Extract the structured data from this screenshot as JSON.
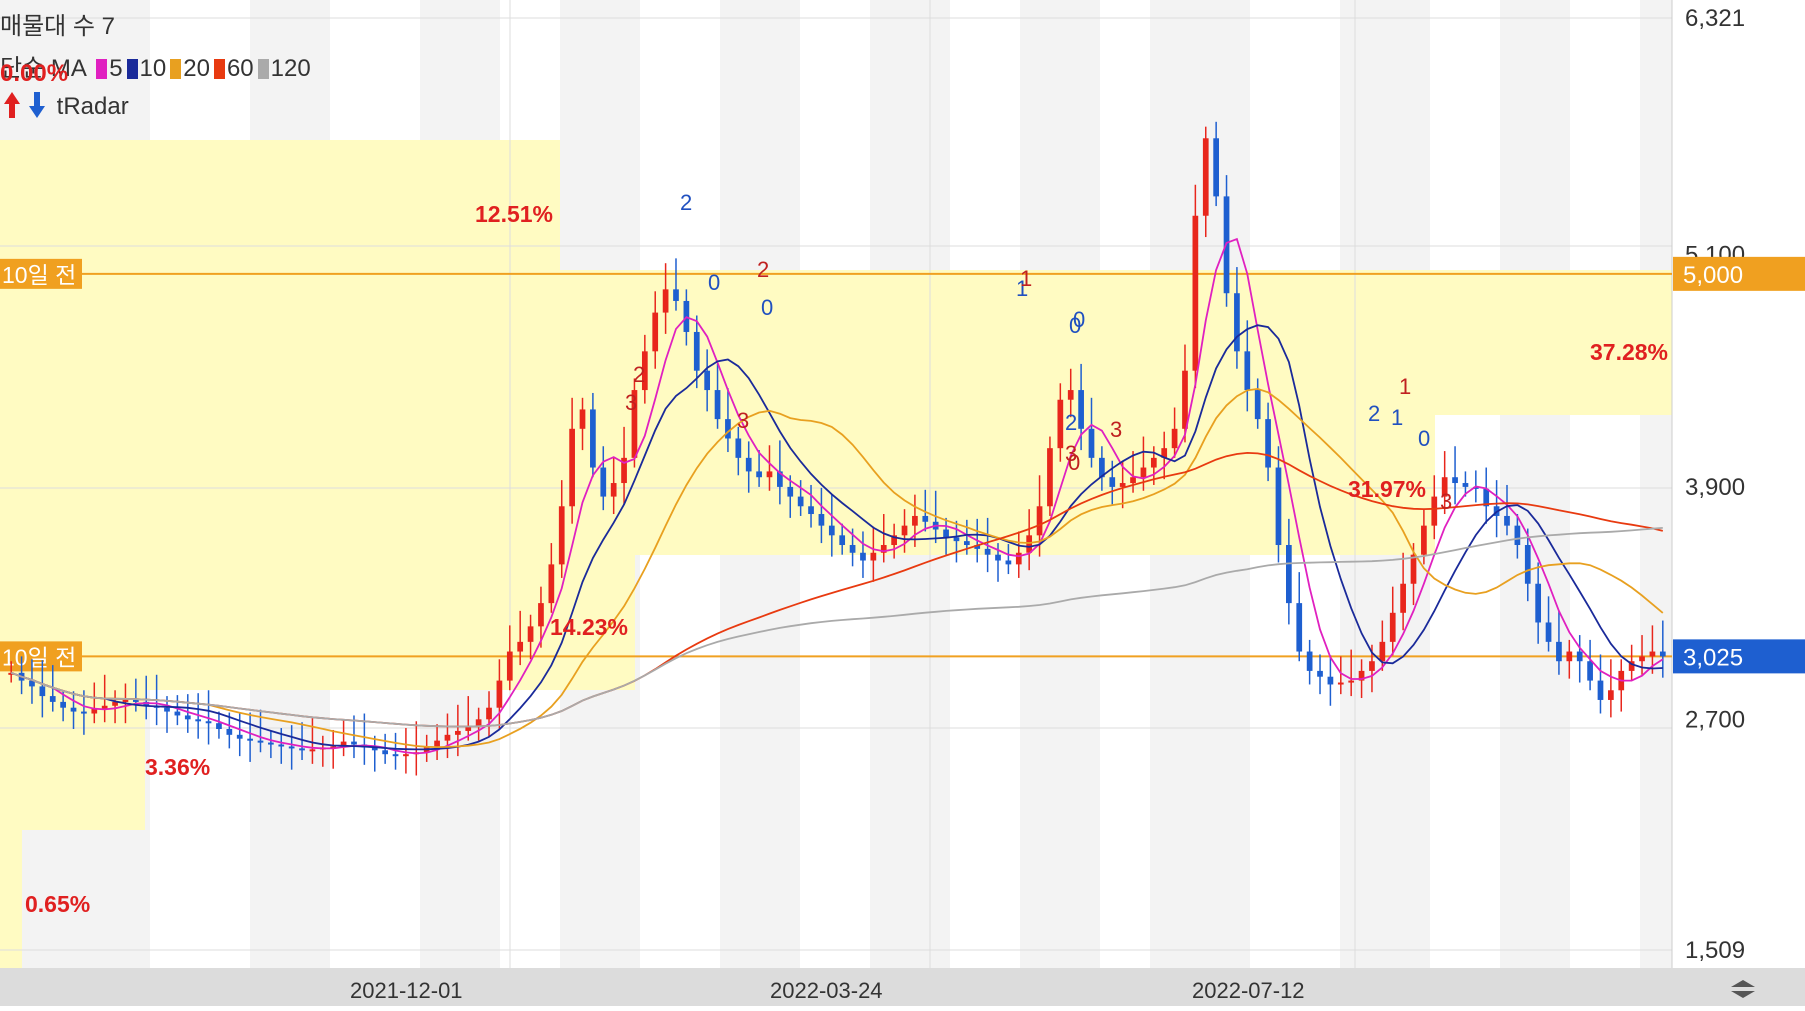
{
  "header": {
    "indicator_volume": "매물대 수 7",
    "ma_label": "단순 MA",
    "ma_items": [
      {
        "label": "5",
        "color": "#e020c0"
      },
      {
        "label": "10",
        "color": "#1a2a9a"
      },
      {
        "label": "20",
        "color": "#e8a020"
      },
      {
        "label": "60",
        "color": "#e83a10"
      },
      {
        "label": "120",
        "color": "#aaaaaa"
      }
    ],
    "pct_top": "0.00%",
    "radar_label": "tRadar",
    "up_icon": "red-up-arrow-icon",
    "down_icon": "blue-down-arrow-icon"
  },
  "chart_data": {
    "type": "candlestick",
    "y_ticks": [
      "6,321",
      "5,100",
      "3,900",
      "2,700",
      "1,509"
    ],
    "ylim": [
      1509,
      6321
    ],
    "x_tick_labels": [
      "2021-12-01",
      "2022-03-24",
      "2022-07-12"
    ],
    "price_labels": [
      {
        "value": "5,000",
        "color": "#f0a020"
      },
      {
        "value": "3,025",
        "color": "#1e5fd0"
      }
    ],
    "hlines": [
      {
        "label": "10일 전",
        "value": 5000
      },
      {
        "label": "10일 전",
        "value": 3025
      }
    ],
    "volume_zone_pcts": [
      "12.51%",
      "37.28%",
      "14.23%",
      "31.97%",
      "3.36%",
      "0.65%"
    ],
    "close_series": [
      2940,
      2900,
      2870,
      2820,
      2790,
      2760,
      2740,
      2730,
      2755,
      2770,
      2790,
      2800,
      2790,
      2770,
      2760,
      2740,
      2720,
      2700,
      2690,
      2680,
      2650,
      2620,
      2600,
      2590,
      2580,
      2570,
      2560,
      2550,
      2540,
      2545,
      2555,
      2560,
      2585,
      2570,
      2555,
      2540,
      2520,
      2510,
      2520,
      2530,
      2560,
      2590,
      2620,
      2640,
      2660,
      2700,
      2760,
      2900,
      3050,
      3100,
      3180,
      3300,
      3500,
      3800,
      4200,
      4300,
      4000,
      3850,
      3920,
      4050,
      4400,
      4600,
      4800,
      4920,
      4860,
      4700,
      4500,
      4400,
      4250,
      4150,
      4050,
      3980,
      3950,
      3980,
      3900,
      3850,
      3800,
      3760,
      3700,
      3650,
      3600,
      3560,
      3520,
      3560,
      3600,
      3650,
      3700,
      3750,
      3720,
      3680,
      3640,
      3620,
      3600,
      3580,
      3550,
      3520,
      3500,
      3560,
      3650,
      3800,
      4100,
      4350,
      4400,
      4200,
      4050,
      3950,
      3900,
      3920,
      3950,
      4000,
      4050,
      4100,
      4200,
      4500,
      5300,
      5700,
      5400,
      4900,
      4600,
      4400,
      4250,
      4000,
      3600,
      3300,
      3050,
      2950,
      2920,
      2880,
      2890,
      2900,
      2950,
      3000,
      3100,
      3250,
      3400,
      3550,
      3700,
      3850,
      3950,
      3920,
      3900,
      3890,
      3800,
      3750,
      3700,
      3600,
      3400,
      3200,
      3100,
      3000,
      3050,
      3000,
      2900,
      2800,
      2850,
      2950,
      3000,
      3025,
      3050,
      3025
    ],
    "gaps_text": "1 2 3 0",
    "signal_labels": [
      "2",
      "0",
      "2",
      "0",
      "3",
      "2",
      "3",
      "1",
      "1",
      "0",
      "0",
      "3",
      "2",
      "3",
      "0",
      "1",
      "2",
      "1",
      "0",
      "3"
    ]
  }
}
